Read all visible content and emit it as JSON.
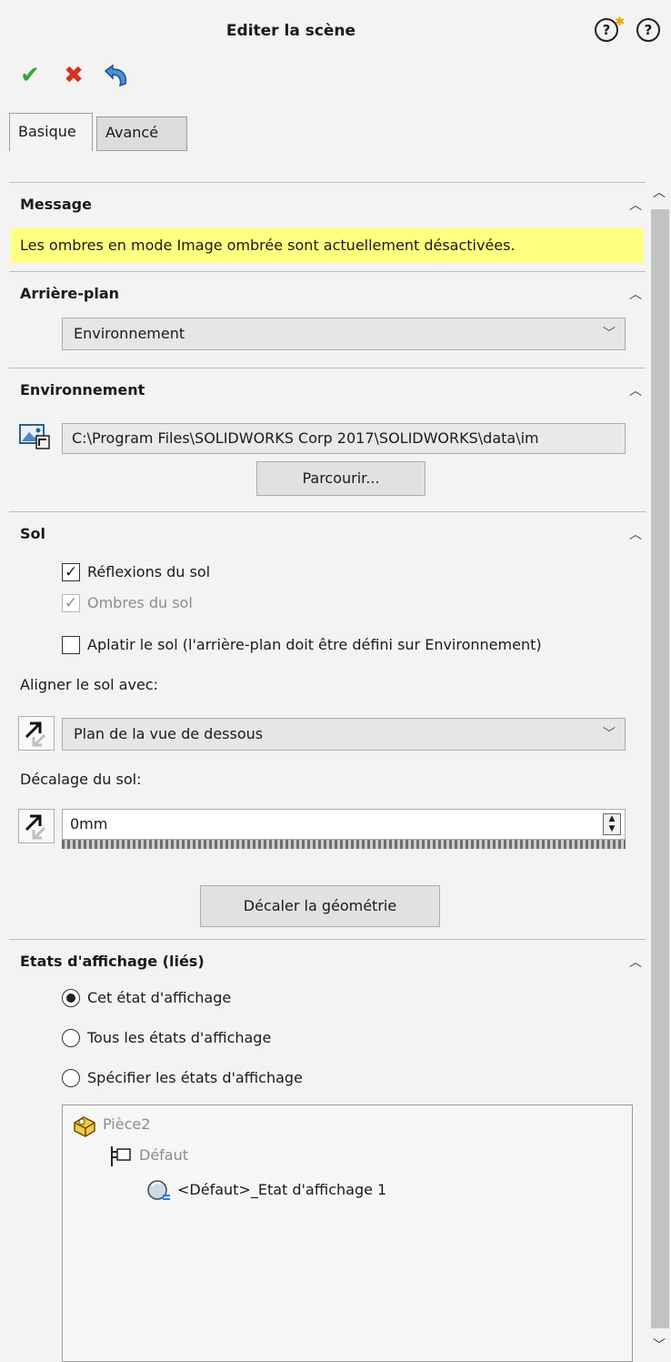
{
  "window": {
    "title": "Editer la scène",
    "help_whats_new": "?",
    "help": "?"
  },
  "actions": {
    "ok": "✔",
    "cancel": "✖"
  },
  "tabs": [
    {
      "label": "Basique",
      "active": true
    },
    {
      "label": "Avancé",
      "active": false
    }
  ],
  "message": {
    "title": "Message",
    "text": "Les ombres en mode Image ombrée sont actuellement désactivées."
  },
  "background": {
    "title": "Arrière-plan",
    "selected": "Environnement"
  },
  "environment": {
    "title": "Environnement",
    "path": "C:\\Program Files\\SOLIDWORKS Corp 2017\\SOLIDWORKS\\data\\im",
    "browse_label": "Parcourir..."
  },
  "floor": {
    "title": "Sol",
    "reflections_label": "Réflexions du sol",
    "reflections_checked": true,
    "shadows_label": "Ombres du sol",
    "shadows_checked": true,
    "shadows_enabled": false,
    "flatten_label": "Aplatir le sol (l'arrière-plan doit être défini sur Environnement)",
    "flatten_checked": false,
    "align_label": "Aligner le sol avec:",
    "align_selected": "Plan de la vue de dessous",
    "offset_label": "Décalage du sol:",
    "offset_value": "0mm",
    "offset_button": "Décaler la géométrie"
  },
  "display_states": {
    "title": "Etats d'affichage (liés)",
    "options": [
      {
        "label": "Cet état d'affichage",
        "selected": true
      },
      {
        "label": "Tous les états d'affichage",
        "selected": false
      },
      {
        "label": "Spécifier les états d'affichage",
        "selected": false
      }
    ],
    "tree": {
      "part": "Pièce2",
      "config": "Défaut",
      "state": "<Défaut>_Etat d'affichage 1"
    }
  }
}
